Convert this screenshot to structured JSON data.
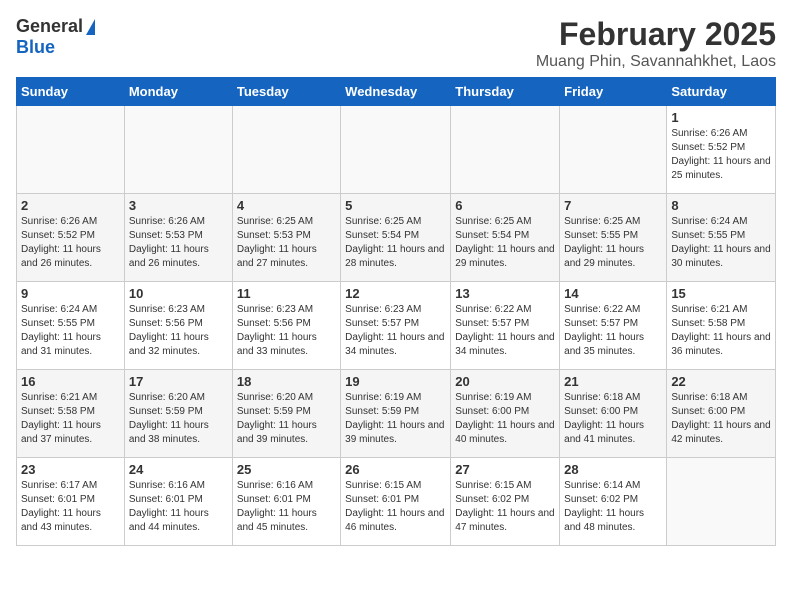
{
  "header": {
    "logo_general": "General",
    "logo_blue": "Blue",
    "month": "February 2025",
    "location": "Muang Phin, Savannahkhet, Laos"
  },
  "columns": [
    "Sunday",
    "Monday",
    "Tuesday",
    "Wednesday",
    "Thursday",
    "Friday",
    "Saturday"
  ],
  "weeks": [
    [
      {
        "day": "",
        "info": ""
      },
      {
        "day": "",
        "info": ""
      },
      {
        "day": "",
        "info": ""
      },
      {
        "day": "",
        "info": ""
      },
      {
        "day": "",
        "info": ""
      },
      {
        "day": "",
        "info": ""
      },
      {
        "day": "1",
        "info": "Sunrise: 6:26 AM\nSunset: 5:52 PM\nDaylight: 11 hours and 25 minutes."
      }
    ],
    [
      {
        "day": "2",
        "info": "Sunrise: 6:26 AM\nSunset: 5:52 PM\nDaylight: 11 hours and 26 minutes."
      },
      {
        "day": "3",
        "info": "Sunrise: 6:26 AM\nSunset: 5:53 PM\nDaylight: 11 hours and 26 minutes."
      },
      {
        "day": "4",
        "info": "Sunrise: 6:25 AM\nSunset: 5:53 PM\nDaylight: 11 hours and 27 minutes."
      },
      {
        "day": "5",
        "info": "Sunrise: 6:25 AM\nSunset: 5:54 PM\nDaylight: 11 hours and 28 minutes."
      },
      {
        "day": "6",
        "info": "Sunrise: 6:25 AM\nSunset: 5:54 PM\nDaylight: 11 hours and 29 minutes."
      },
      {
        "day": "7",
        "info": "Sunrise: 6:25 AM\nSunset: 5:55 PM\nDaylight: 11 hours and 29 minutes."
      },
      {
        "day": "8",
        "info": "Sunrise: 6:24 AM\nSunset: 5:55 PM\nDaylight: 11 hours and 30 minutes."
      }
    ],
    [
      {
        "day": "9",
        "info": "Sunrise: 6:24 AM\nSunset: 5:55 PM\nDaylight: 11 hours and 31 minutes."
      },
      {
        "day": "10",
        "info": "Sunrise: 6:23 AM\nSunset: 5:56 PM\nDaylight: 11 hours and 32 minutes."
      },
      {
        "day": "11",
        "info": "Sunrise: 6:23 AM\nSunset: 5:56 PM\nDaylight: 11 hours and 33 minutes."
      },
      {
        "day": "12",
        "info": "Sunrise: 6:23 AM\nSunset: 5:57 PM\nDaylight: 11 hours and 34 minutes."
      },
      {
        "day": "13",
        "info": "Sunrise: 6:22 AM\nSunset: 5:57 PM\nDaylight: 11 hours and 34 minutes."
      },
      {
        "day": "14",
        "info": "Sunrise: 6:22 AM\nSunset: 5:57 PM\nDaylight: 11 hours and 35 minutes."
      },
      {
        "day": "15",
        "info": "Sunrise: 6:21 AM\nSunset: 5:58 PM\nDaylight: 11 hours and 36 minutes."
      }
    ],
    [
      {
        "day": "16",
        "info": "Sunrise: 6:21 AM\nSunset: 5:58 PM\nDaylight: 11 hours and 37 minutes."
      },
      {
        "day": "17",
        "info": "Sunrise: 6:20 AM\nSunset: 5:59 PM\nDaylight: 11 hours and 38 minutes."
      },
      {
        "day": "18",
        "info": "Sunrise: 6:20 AM\nSunset: 5:59 PM\nDaylight: 11 hours and 39 minutes."
      },
      {
        "day": "19",
        "info": "Sunrise: 6:19 AM\nSunset: 5:59 PM\nDaylight: 11 hours and 39 minutes."
      },
      {
        "day": "20",
        "info": "Sunrise: 6:19 AM\nSunset: 6:00 PM\nDaylight: 11 hours and 40 minutes."
      },
      {
        "day": "21",
        "info": "Sunrise: 6:18 AM\nSunset: 6:00 PM\nDaylight: 11 hours and 41 minutes."
      },
      {
        "day": "22",
        "info": "Sunrise: 6:18 AM\nSunset: 6:00 PM\nDaylight: 11 hours and 42 minutes."
      }
    ],
    [
      {
        "day": "23",
        "info": "Sunrise: 6:17 AM\nSunset: 6:01 PM\nDaylight: 11 hours and 43 minutes."
      },
      {
        "day": "24",
        "info": "Sunrise: 6:16 AM\nSunset: 6:01 PM\nDaylight: 11 hours and 44 minutes."
      },
      {
        "day": "25",
        "info": "Sunrise: 6:16 AM\nSunset: 6:01 PM\nDaylight: 11 hours and 45 minutes."
      },
      {
        "day": "26",
        "info": "Sunrise: 6:15 AM\nSunset: 6:01 PM\nDaylight: 11 hours and 46 minutes."
      },
      {
        "day": "27",
        "info": "Sunrise: 6:15 AM\nSunset: 6:02 PM\nDaylight: 11 hours and 47 minutes."
      },
      {
        "day": "28",
        "info": "Sunrise: 6:14 AM\nSunset: 6:02 PM\nDaylight: 11 hours and 48 minutes."
      },
      {
        "day": "",
        "info": ""
      }
    ]
  ]
}
